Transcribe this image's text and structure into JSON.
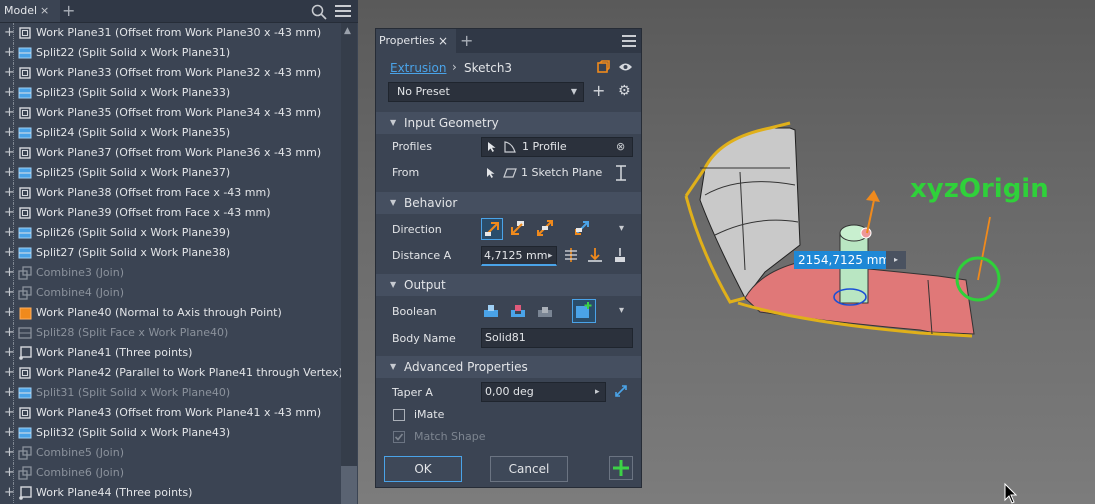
{
  "model_panel": {
    "tab_title": "Model",
    "close_glyph": "×",
    "add_glyph": "+",
    "tree": [
      {
        "label": "Work Plane31 (Offset from Work Plane30 x -43 mm)",
        "icon": "work-plane-icon",
        "dim": false
      },
      {
        "label": "Split22 (Split Solid x Work Plane31)",
        "icon": "split-icon",
        "dim": false
      },
      {
        "label": "Work Plane33 (Offset from Work Plane32 x -43 mm)",
        "icon": "work-plane-icon",
        "dim": false
      },
      {
        "label": "Split23 (Split Solid x Work Plane33)",
        "icon": "split-icon",
        "dim": false
      },
      {
        "label": "Work Plane35 (Offset from Work Plane34 x -43 mm)",
        "icon": "work-plane-icon",
        "dim": false
      },
      {
        "label": "Split24 (Split Solid x Work Plane35)",
        "icon": "split-icon",
        "dim": false
      },
      {
        "label": "Work Plane37 (Offset from Work Plane36 x -43 mm)",
        "icon": "work-plane-icon",
        "dim": false
      },
      {
        "label": "Split25 (Split Solid x Work Plane37)",
        "icon": "split-icon",
        "dim": false
      },
      {
        "label": "Work Plane38 (Offset from Face x -43 mm)",
        "icon": "work-plane-icon",
        "dim": false
      },
      {
        "label": "Work Plane39 (Offset from Face x -43 mm)",
        "icon": "work-plane-icon",
        "dim": false
      },
      {
        "label": "Split26 (Split Solid x Work Plane39)",
        "icon": "split-icon",
        "dim": false
      },
      {
        "label": "Split27 (Split Solid x Work Plane38)",
        "icon": "split-icon",
        "dim": false
      },
      {
        "label": "Combine3 (Join)",
        "icon": "combine-icon",
        "dim": true
      },
      {
        "label": "Combine4 (Join)",
        "icon": "combine-icon",
        "dim": true
      },
      {
        "label": "Work Plane40 (Normal to Axis through Point)",
        "icon": "work-plane-orange-icon",
        "dim": false
      },
      {
        "label": "Split28 (Split Face x Work Plane40)",
        "icon": "split-face-icon",
        "dim": true
      },
      {
        "label": "Work Plane41 (Three points)",
        "icon": "work-plane-points-icon",
        "dim": false
      },
      {
        "label": "Work Plane42 (Parallel to Work Plane41 through Vertex)",
        "icon": "work-plane-icon",
        "dim": false
      },
      {
        "label": "Split31 (Split Solid x Work Plane40)",
        "icon": "split-icon",
        "dim": true
      },
      {
        "label": "Work Plane43 (Offset from Work Plane41 x -43 mm)",
        "icon": "work-plane-icon",
        "dim": false
      },
      {
        "label": "Split32 (Split Solid x Work Plane43)",
        "icon": "split-icon",
        "dim": false
      },
      {
        "label": "Combine5 (Join)",
        "icon": "combine-icon",
        "dim": true
      },
      {
        "label": "Combine6 (Join)",
        "icon": "combine-icon",
        "dim": true
      },
      {
        "label": "Work Plane44 (Three points)",
        "icon": "work-plane-points-icon",
        "dim": false
      }
    ]
  },
  "properties": {
    "tab_title": "Properties",
    "close_glyph": "×",
    "add_glyph": "+",
    "breadcrumb": {
      "link": "Extrusion",
      "separator": "›",
      "current": "Sketch3"
    },
    "preset": {
      "value": "No Preset",
      "add_glyph": "+",
      "gear_glyph": "⚙"
    },
    "sections": {
      "input_geometry": "Input Geometry",
      "behavior": "Behavior",
      "output": "Output",
      "advanced": "Advanced Properties"
    },
    "profiles": {
      "label": "Profiles",
      "value": "1 Profile",
      "clear_glyph": "⊗"
    },
    "from": {
      "label": "From",
      "value": "1 Sketch Plane"
    },
    "direction": {
      "label": "Direction",
      "caret": "▾"
    },
    "distance_a": {
      "label": "Distance A",
      "value": "4,7125 mm",
      "arrow": "▸"
    },
    "boolean": {
      "label": "Boolean",
      "caret": "▾"
    },
    "body_name": {
      "label": "Body Name",
      "value": "Solid81"
    },
    "taper_a": {
      "label": "Taper A",
      "value": "0,00 deg",
      "arrow": "▸"
    },
    "imate": {
      "label": "iMate",
      "checked": false
    },
    "match_shape": {
      "label": "Match Shape",
      "checked": true,
      "disabled": true
    },
    "buttons": {
      "ok": "OK",
      "cancel": "Cancel"
    }
  },
  "viewport": {
    "dimension_value": "2154,7125 mm",
    "dimension_arrow": "▸",
    "origin_label": "xyzOrigin",
    "origin_color": "#2fd13a",
    "arrow_color": "#f08a1c"
  }
}
